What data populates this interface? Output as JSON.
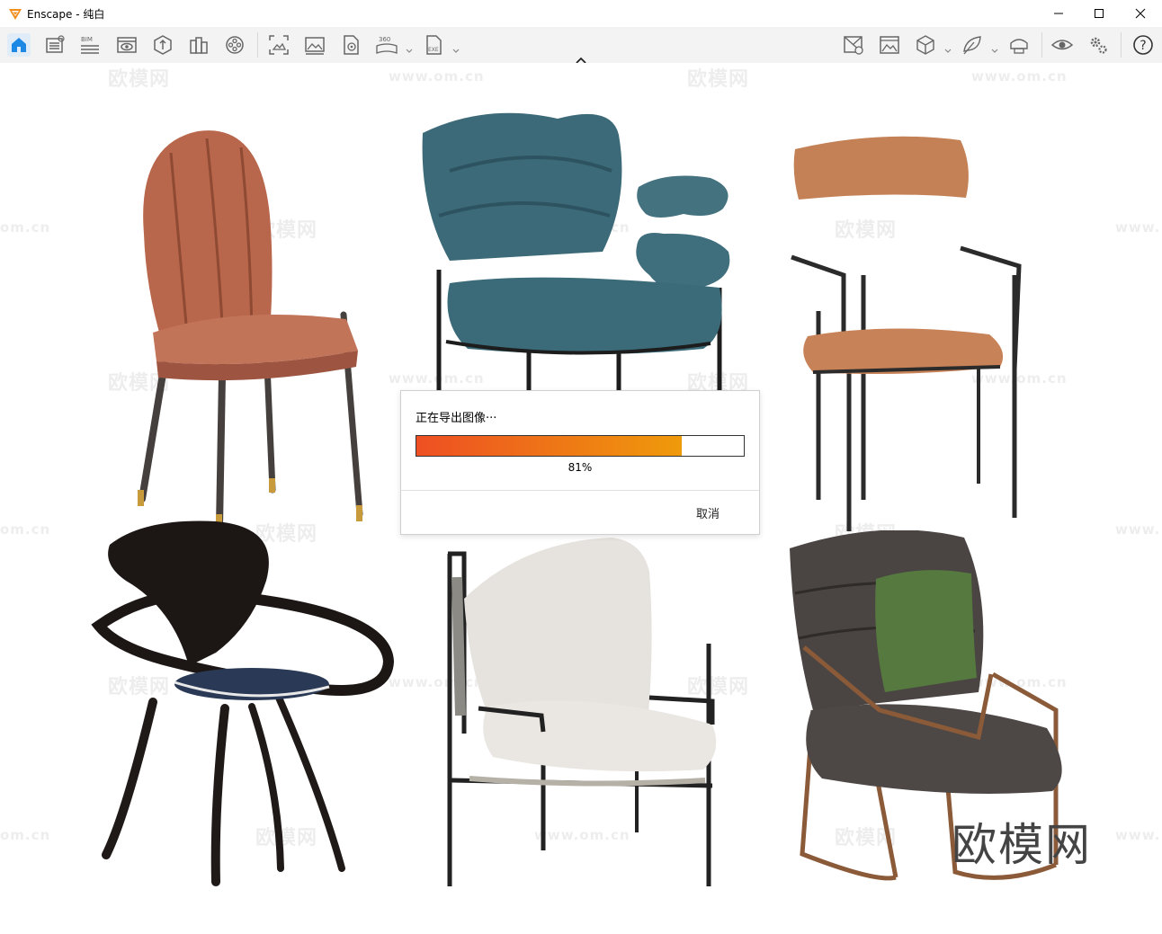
{
  "window": {
    "title": "Enscape - 纯白"
  },
  "toolbar": {
    "left_icons": [
      "home-icon",
      "views-icon",
      "bim-icon",
      "visual-settings-icon",
      "asset-library-icon",
      "material-editor-icon",
      "video-editor-icon",
      "capture-screenshot-icon",
      "image-batch-icon",
      "export-panorama-icon",
      "panorama-360-icon",
      "exe-export-icon"
    ],
    "bim_label": "BIM",
    "pano_label": "360",
    "exe_label": "EXE",
    "right_icons": [
      "sync-selection-icon",
      "rendering-icon",
      "views-cube-icon",
      "feedback-icon",
      "vr-headset-icon",
      "visibility-icon",
      "settings-icon",
      "help-icon"
    ],
    "help_label": "?"
  },
  "watermark": {
    "brand": "欧模网",
    "site": "www.om.cn",
    "site_partial_left": "om.cn",
    "site_partial_right": "www."
  },
  "scene": {
    "chairs": [
      "leather-dining-chair",
      "blue-lounge-chair",
      "tan-armchair",
      "black-bentwood-chair",
      "white-armchair",
      "grey-cushion-chair"
    ]
  },
  "export_dialog": {
    "title": "正在导出图像···",
    "progress_percent": 81,
    "progress_text": "81%",
    "cancel_label": "取消",
    "gradient_start": "#ee4f23",
    "gradient_end": "#ef9a0b"
  }
}
